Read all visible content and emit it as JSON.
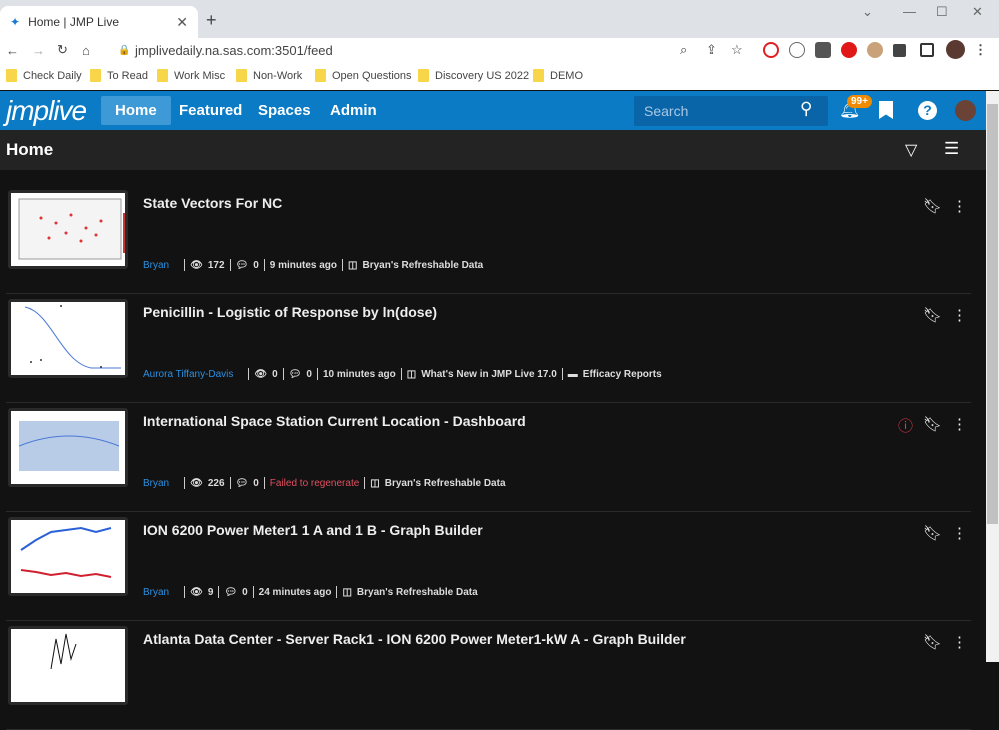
{
  "browser": {
    "tab_title": "Home | JMP Live",
    "url": "jmplivedaily.na.sas.com:3501/feed",
    "bookmarks": [
      "Check Daily",
      "To Read",
      "Work Misc",
      "Non-Work",
      "Open Questions",
      "Discovery US 2022",
      "DEMO"
    ]
  },
  "app": {
    "logo": "jmplive",
    "nav": [
      "Home",
      "Featured",
      "Spaces",
      "Admin"
    ],
    "search_placeholder": "Search",
    "notification_count": "99+",
    "page_title": "Home"
  },
  "colors": {
    "header": "#0a7bc4",
    "author": "#2b8fe0",
    "error": "#e05060"
  },
  "posts": [
    {
      "title": "State Vectors For NC",
      "author": "Bryan",
      "views": "172",
      "comments": "0",
      "time": "9 minutes ago",
      "space": "Bryan's Refreshable Data"
    },
    {
      "title": "Penicillin - Logistic of Response by ln(dose)",
      "author": "Aurora Tiffany-Davis",
      "views": "0",
      "comments": "0",
      "time": "10 minutes ago",
      "space": "What's New in JMP Live 17.0",
      "folder": "Efficacy Reports"
    },
    {
      "title": "International Space Station Current Location - Dashboard",
      "author": "Bryan",
      "views": "226",
      "comments": "0",
      "time": "Failed to regenerate",
      "space": "Bryan's Refreshable Data"
    },
    {
      "title": "ION 6200 Power Meter1 1 A and 1 B - Graph Builder",
      "author": "Bryan",
      "views": "9",
      "comments": "0",
      "time": "24 minutes ago",
      "space": "Bryan's Refreshable Data"
    },
    {
      "title": "Atlanta Data Center - Server Rack1 - ION 6200 Power Meter1-kW A - Graph Builder"
    }
  ]
}
